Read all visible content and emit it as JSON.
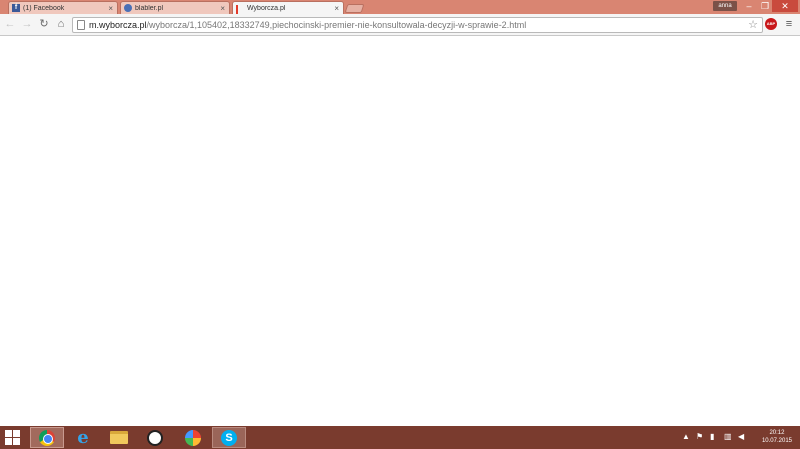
{
  "browser": {
    "tabs": [
      {
        "label": "(1) Facebook",
        "favicon": "facebook-icon",
        "active": false
      },
      {
        "label": "blabler.pl",
        "favicon": "blabler-icon",
        "active": false
      },
      {
        "label": "Wyborcza.pl",
        "favicon": "wyborcza-icon",
        "active": true
      }
    ],
    "user": "anna",
    "url": {
      "host": "m.wyborcza.pl",
      "path": "/wyborcza/1,105402,18332749,piechocinski-premier-nie-konsultowala-decyzji-w-sprawie-2.html"
    },
    "close_symbol": "×"
  },
  "taskbar": {
    "apps": [
      "chrome-icon",
      "internet-explorer-icon",
      "file-explorer-icon",
      "panda-antivirus-icon",
      "picasa-icon",
      "skype-icon"
    ],
    "time": "20:12",
    "date": "10.07.2015"
  }
}
